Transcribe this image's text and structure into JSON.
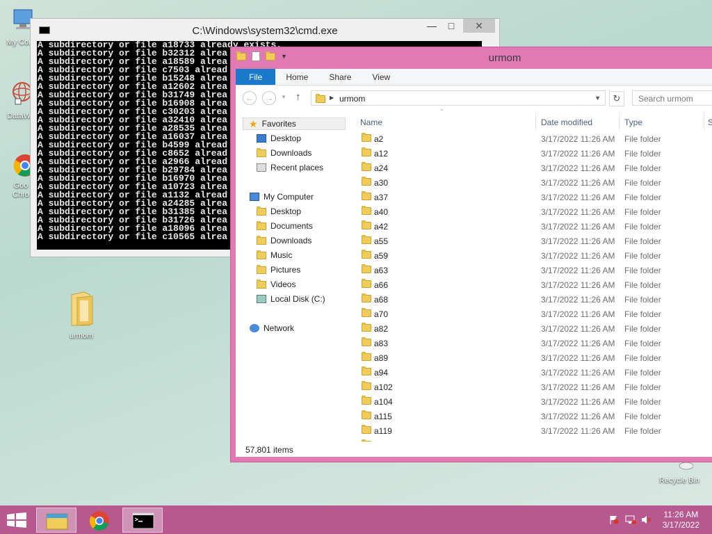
{
  "desktop": {
    "icons": [
      {
        "label": "My Com"
      },
      {
        "label": "DataWa"
      },
      {
        "label": "Goo Chro"
      },
      {
        "label": "urmom"
      },
      {
        "label": "Recycle Bin"
      }
    ]
  },
  "cmd": {
    "title": "C:\\Windows\\system32\\cmd.exe",
    "lines": [
      "A subdirectory or file a18733 already exists.",
      "A subdirectory or file b32312 alrea",
      "A subdirectory or file a18589 alrea",
      "A subdirectory or file c7503 alread",
      "A subdirectory or file b15248 alrea",
      "A subdirectory or file a12602 alrea",
      "A subdirectory or file b31749 alrea",
      "A subdirectory or file b16908 alrea",
      "A subdirectory or file c30203 alrea",
      "A subdirectory or file a32410 alrea",
      "A subdirectory or file a28535 alrea",
      "A subdirectory or file a16037 alrea",
      "A subdirectory or file b4599 alread",
      "A subdirectory or file c8652 alread",
      "A subdirectory or file a2966 alread",
      "A subdirectory or file b29784 alrea",
      "A subdirectory or file b16970 alrea",
      "A subdirectory or file a10723 alrea",
      "A subdirectory or file a1132 alread",
      "A subdirectory or file a24285 alrea",
      "A subdirectory or file b31385 alrea",
      "A subdirectory or file b31726 alrea",
      "A subdirectory or file a18096 alrea",
      "A subdirectory or file c10565 alrea"
    ]
  },
  "explorer": {
    "title": "urmom",
    "ribbon_tabs": [
      "File",
      "Home",
      "Share",
      "View"
    ],
    "address": "urmom",
    "search_placeholder": "Search urmom",
    "nav": {
      "favorites": "Favorites",
      "fav_items": [
        "Desktop",
        "Downloads",
        "Recent places"
      ],
      "computer": "My Computer",
      "comp_items": [
        "Desktop",
        "Documents",
        "Downloads",
        "Music",
        "Pictures",
        "Videos",
        "Local Disk (C:)"
      ],
      "network": "Network"
    },
    "columns": {
      "name": "Name",
      "date": "Date modified",
      "type": "Type",
      "size": "S"
    },
    "rows": [
      {
        "name": "a2",
        "date": "3/17/2022 11:26 AM",
        "type": "File folder"
      },
      {
        "name": "a12",
        "date": "3/17/2022 11:26 AM",
        "type": "File folder"
      },
      {
        "name": "a24",
        "date": "3/17/2022 11:26 AM",
        "type": "File folder"
      },
      {
        "name": "a30",
        "date": "3/17/2022 11:26 AM",
        "type": "File folder"
      },
      {
        "name": "a37",
        "date": "3/17/2022 11:26 AM",
        "type": "File folder"
      },
      {
        "name": "a40",
        "date": "3/17/2022 11:26 AM",
        "type": "File folder"
      },
      {
        "name": "a42",
        "date": "3/17/2022 11:26 AM",
        "type": "File folder"
      },
      {
        "name": "a55",
        "date": "3/17/2022 11:26 AM",
        "type": "File folder"
      },
      {
        "name": "a59",
        "date": "3/17/2022 11:26 AM",
        "type": "File folder"
      },
      {
        "name": "a63",
        "date": "3/17/2022 11:26 AM",
        "type": "File folder"
      },
      {
        "name": "a66",
        "date": "3/17/2022 11:26 AM",
        "type": "File folder"
      },
      {
        "name": "a68",
        "date": "3/17/2022 11:26 AM",
        "type": "File folder"
      },
      {
        "name": "a70",
        "date": "3/17/2022 11:26 AM",
        "type": "File folder"
      },
      {
        "name": "a82",
        "date": "3/17/2022 11:26 AM",
        "type": "File folder"
      },
      {
        "name": "a83",
        "date": "3/17/2022 11:26 AM",
        "type": "File folder"
      },
      {
        "name": "a89",
        "date": "3/17/2022 11:26 AM",
        "type": "File folder"
      },
      {
        "name": "a94",
        "date": "3/17/2022 11:26 AM",
        "type": "File folder"
      },
      {
        "name": "a102",
        "date": "3/17/2022 11:26 AM",
        "type": "File folder"
      },
      {
        "name": "a104",
        "date": "3/17/2022 11:26 AM",
        "type": "File folder"
      },
      {
        "name": "a115",
        "date": "3/17/2022 11:26 AM",
        "type": "File folder"
      },
      {
        "name": "a119",
        "date": "3/17/2022 11:26 AM",
        "type": "File folder"
      }
    ],
    "status": "57,801 items"
  },
  "taskbar": {
    "time": "11:26 AM",
    "date": "3/17/2022"
  },
  "colors": {
    "accent": "#e17ab3",
    "taskbar": "#b7598f",
    "ribbon_file": "#1979ca"
  }
}
